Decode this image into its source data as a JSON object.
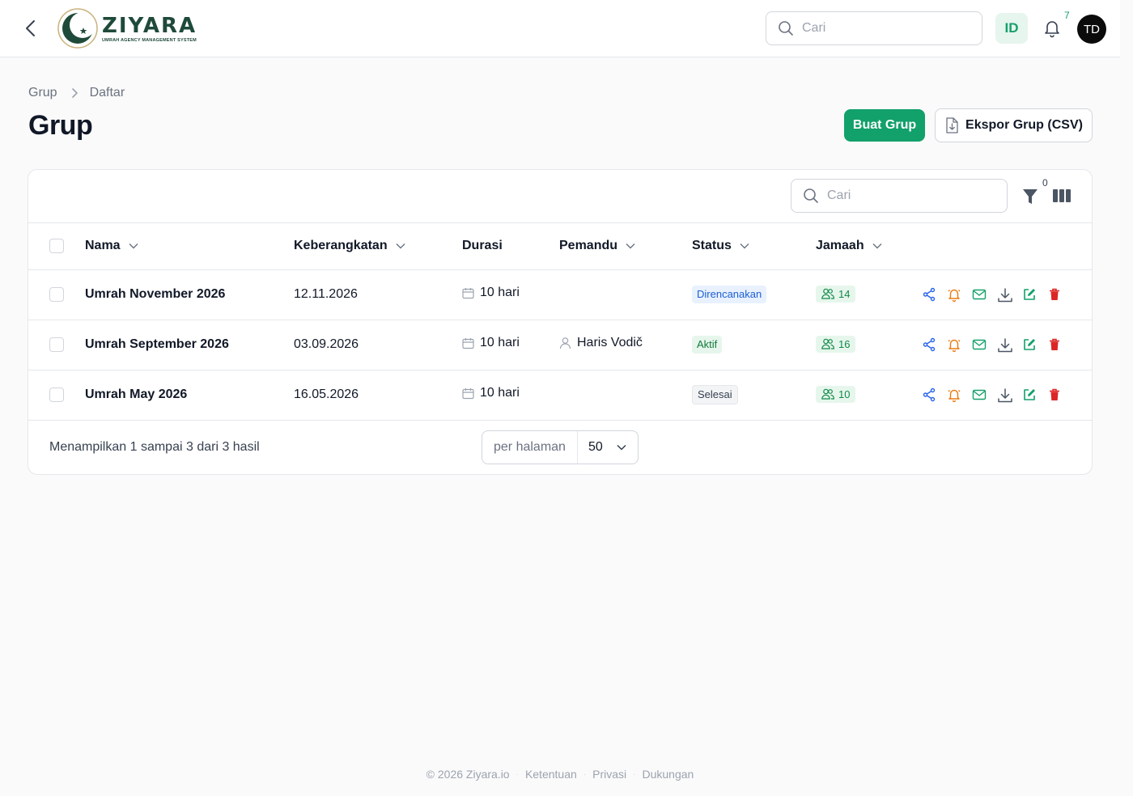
{
  "brand": {
    "name": "ZIYARA",
    "tagline": "UMRAH AGENCY MANAGEMENT SYSTEM",
    "primary_color": "#12a06b",
    "dark_green": "#1f4a3a"
  },
  "topbar": {
    "search_placeholder": "Cari",
    "language": "ID",
    "notification_count": "7",
    "avatar_initials": "TD"
  },
  "breadcrumb": {
    "items": [
      "Grup",
      "Daftar"
    ]
  },
  "page": {
    "title": "Grup",
    "create_button": "Buat Grup",
    "export_button": "Ekspor Grup (CSV)"
  },
  "table_toolbar": {
    "search_placeholder": "Cari",
    "filter_count": "0"
  },
  "table": {
    "columns": {
      "name": "Nama",
      "departure": "Keberangkatan",
      "duration": "Durasi",
      "guide": "Pemandu",
      "status": "Status",
      "pilgrims": "Jamaah"
    },
    "rows": [
      {
        "name": "Umrah November 2026",
        "departure": "12.11.2026",
        "duration": "10 hari",
        "guide": "",
        "status": "Direncanakan",
        "status_kind": "planned",
        "pilgrims": "14"
      },
      {
        "name": "Umrah September 2026",
        "departure": "03.09.2026",
        "duration": "10 hari",
        "guide": "Haris Vodič",
        "status": "Aktif",
        "status_kind": "active",
        "pilgrims": "16"
      },
      {
        "name": "Umrah May 2026",
        "departure": "16.05.2026",
        "duration": "10 hari",
        "guide": "",
        "status": "Selesai",
        "status_kind": "done",
        "pilgrims": "10"
      }
    ],
    "row_action_icons": [
      "share-icon",
      "bell-icon",
      "mail-icon",
      "download-icon",
      "edit-icon",
      "trash-icon"
    ]
  },
  "pagination": {
    "summary": "Menampilkan 1 sampai 3 dari 3 hasil",
    "per_page_label": "per halaman",
    "per_page_value": "50"
  },
  "footer": {
    "copyright": "© 2026 Ziyara.io",
    "links": [
      "Ketentuan",
      "Privasi",
      "Dukungan"
    ]
  }
}
